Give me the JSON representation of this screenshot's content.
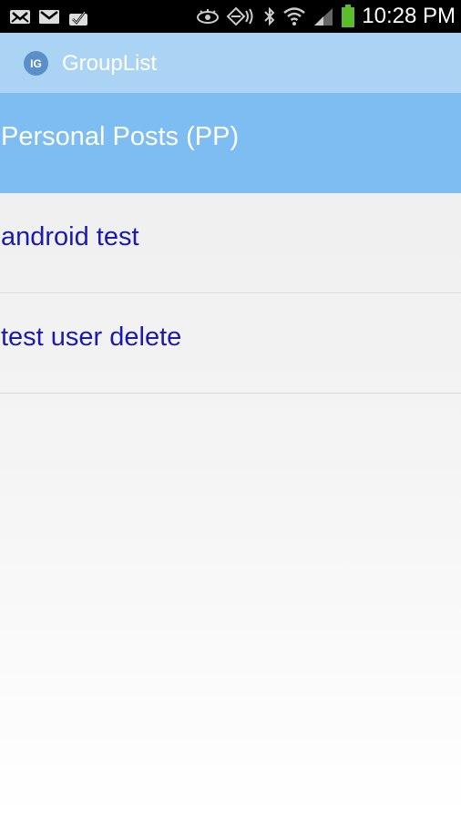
{
  "status_bar": {
    "left_icons": [
      "missed-call-icon",
      "gmail-icon",
      "download-icon"
    ],
    "right_icons": [
      "eye-icon",
      "nfc-icon",
      "bluetooth-icon",
      "wifi-icon",
      "signal-icon",
      "battery-icon"
    ],
    "time": "10:28 PM"
  },
  "action_bar": {
    "logo_text": "IG",
    "title": "GroupList"
  },
  "groups": [
    {
      "label": "Personal Posts (PP)",
      "selected": true
    },
    {
      "label": "android test",
      "selected": false
    },
    {
      "label": "test user delete",
      "selected": false
    }
  ],
  "colors": {
    "action_bar_bg": "#abd3f4",
    "selected_item_bg": "#7dbdf1",
    "item_text": "#1a1ab2"
  }
}
